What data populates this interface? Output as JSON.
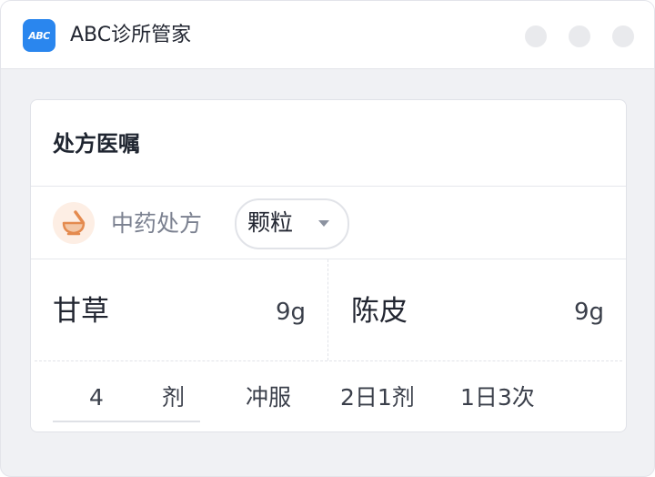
{
  "app": {
    "logo_text": "ABC",
    "title": "ABC诊所管家",
    "window_controls": [
      "minimize",
      "maximize",
      "close"
    ]
  },
  "card": {
    "title": "处方医嘱",
    "prescription_type": "中药处方",
    "prescription_icon": "mortar-pestle-icon",
    "form": {
      "selected": "颗粒"
    },
    "herbs": [
      {
        "name": "甘草",
        "amount": "9g"
      },
      {
        "name": "陈皮",
        "amount": "9g"
      }
    ],
    "dosage": {
      "count": "4",
      "unit": "剂",
      "method": "冲服",
      "frequency": "2日1剂",
      "times_per_day": "1日3次"
    }
  },
  "colors": {
    "brand": "#2a86ee",
    "window_bg": "#f0f1f4",
    "icon_bg": "#fdeee4",
    "icon_accent": "#e48a4e"
  }
}
